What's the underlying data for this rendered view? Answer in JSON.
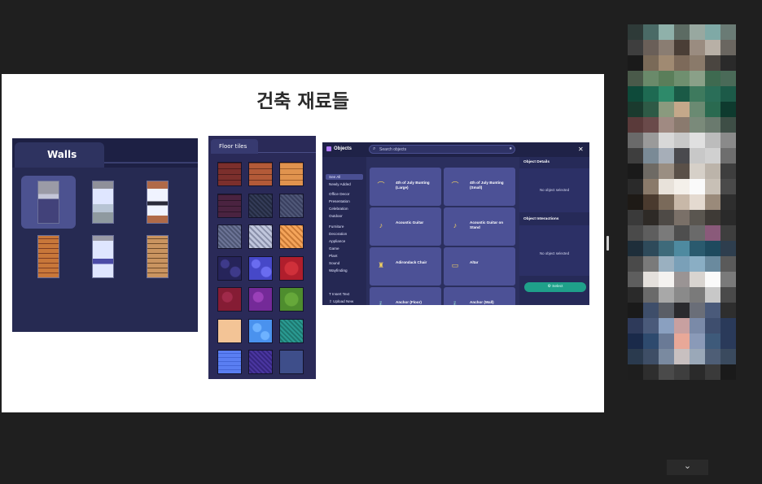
{
  "slide": {
    "title": "건축 재료들"
  },
  "walls": {
    "tab_label": "Walls",
    "items": [
      {
        "name": "wall-gray-purple",
        "style": "w1"
      },
      {
        "name": "wall-light-blue",
        "style": "w2"
      },
      {
        "name": "wall-brick-stripe",
        "style": "w3"
      },
      {
        "name": "wall-orange-brick",
        "style": "w4"
      },
      {
        "name": "wall-blue-stripe",
        "style": "w5"
      },
      {
        "name": "wall-tan-brick",
        "style": "w6"
      }
    ]
  },
  "floor": {
    "tab_label": "Floor tiles",
    "tiles": [
      "t-wood-dark",
      "t-wood-mid",
      "t-wood-light",
      "t-plum",
      "t-dark-diag",
      "t-slate-diag",
      "t-grey-diag",
      "t-silver-diag",
      "t-orange-diag",
      "t-navy-stone",
      "t-blue-stone",
      "t-red",
      "t-crimson",
      "t-violet",
      "t-green",
      "t-peach",
      "t-sky",
      "t-teal",
      "t-royal",
      "t-indigo",
      "t-steel"
    ]
  },
  "objects": {
    "title": "Objects",
    "search_placeholder": "Search objects",
    "categories": [
      {
        "label": "See All",
        "selected": true
      },
      {
        "label": "Newly Added"
      },
      {
        "label": "Office Decor"
      },
      {
        "label": "Presentation"
      },
      {
        "label": "Celebration"
      },
      {
        "label": "Outdoor"
      },
      {
        "label": "Furniture"
      },
      {
        "label": "Decoration"
      },
      {
        "label": "Appliance"
      },
      {
        "label": "Game"
      },
      {
        "label": "Plant"
      },
      {
        "label": "Sound"
      },
      {
        "label": "Wayfinding"
      }
    ],
    "footer_actions": [
      {
        "label": "Insert Text",
        "icon": "text-icon"
      },
      {
        "label": "Upload New",
        "icon": "upload-icon"
      }
    ],
    "items": [
      {
        "label": "4th of July Bunting (Large)",
        "icon": "bunting-icon"
      },
      {
        "label": "4th of July Bunting (Small)",
        "icon": "bunting-icon"
      },
      {
        "label": "Acoustic Guitar",
        "icon": "guitar-icon"
      },
      {
        "label": "Acoustic Guitar on Stand",
        "icon": "guitar-icon"
      },
      {
        "label": "Adirondack Chair",
        "icon": "chair-icon"
      },
      {
        "label": "Altar",
        "icon": "altar-icon"
      },
      {
        "label": "Anchor (Floor)",
        "icon": "anchor-icon"
      },
      {
        "label": "Anchor (Wall)",
        "icon": "anchor-icon"
      }
    ],
    "details": {
      "heading": "Object Details",
      "empty": "No object selected"
    },
    "interactions": {
      "heading": "Object Interactions",
      "empty": "No object selected"
    },
    "select_label": "Select"
  },
  "camera_colors": [
    [
      "#2e3a38",
      "#4a6a66",
      "#8fb1aa",
      "#5c6b63",
      "#98a8a0",
      "#7fa9a6",
      "#6a7b75"
    ],
    [
      "#3e3e3e",
      "#6a5f58",
      "#8a7d72",
      "#4a3e36",
      "#9a8c80",
      "#b8b0a6",
      "#6a6660"
    ],
    [
      "#1a1a1a",
      "#7a6a58",
      "#a08a72",
      "#7d6a5a",
      "#8a7a6a",
      "#4a4540",
      "#2a2a2a"
    ],
    [
      "#4a5a4a",
      "#6a8a6a",
      "#5a7e5a",
      "#6f8f6f",
      "#8aa088",
      "#3e6a50",
      "#4a6a58"
    ],
    [
      "#0e4a3a",
      "#1e6a52",
      "#2e8a6a",
      "#1a5a46",
      "#3e7a5e",
      "#2a6e58",
      "#1c5a48"
    ],
    [
      "#1a3a2e",
      "#2e5a46",
      "#8a9a7e",
      "#c4a88a",
      "#6a8a72",
      "#2a6a50",
      "#0e3a2e"
    ],
    [
      "#5a3a3a",
      "#6a4a4a",
      "#a08a82",
      "#8a7a6e",
      "#7a8a7a",
      "#6a7a6e",
      "#3e4e46"
    ],
    [
      "#6a6a6a",
      "#9a9a9a",
      "#d8d8d8",
      "#c8c8c8",
      "#e0e0e0",
      "#bcbcbc",
      "#8a8a8a"
    ],
    [
      "#3e3e3e",
      "#7a8a96",
      "#a6aeb8",
      "#4a4a4e",
      "#c8c8c8",
      "#d0d0d0",
      "#6e6e6e"
    ],
    [
      "#1a1a1a",
      "#6e6a64",
      "#9a8e82",
      "#5a5048",
      "#d6d0c8",
      "#bcb4aa",
      "#3e3e3e"
    ],
    [
      "#2a2a2a",
      "#8a7a6a",
      "#e8e2da",
      "#f4f0ea",
      "#fafafa",
      "#c8c0b6",
      "#4a4a4a"
    ],
    [
      "#1e1a16",
      "#4a3a2e",
      "#7a6a5a",
      "#c8b8a8",
      "#e4dad0",
      "#9a8a7a",
      "#2e2e2e"
    ],
    [
      "#3a3a3a",
      "#2e2a26",
      "#4e4a46",
      "#7a7068",
      "#5a5650",
      "#3e3a36",
      "#2a2a2a"
    ],
    [
      "#4a4a4a",
      "#5e5e5e",
      "#7a7a7a",
      "#4e4e4e",
      "#6a6a6a",
      "#8a5a7a",
      "#3e3e3e"
    ],
    [
      "#1e2e3a",
      "#2e4a5a",
      "#3e6a7a",
      "#4e8aa0",
      "#2a5a6e",
      "#1e4a5e",
      "#2e3e4e"
    ],
    [
      "#4a4a4a",
      "#7a7a7a",
      "#9ab0c0",
      "#7aa0b8",
      "#8aaec4",
      "#6a8a9e",
      "#5a5a5a"
    ],
    [
      "#5e5e5e",
      "#e4e0dc",
      "#f4f2f0",
      "#9a9494",
      "#d8d4d0",
      "#fafafa",
      "#7a7a7a"
    ],
    [
      "#2a2a2a",
      "#6a6a6a",
      "#a8a8a8",
      "#8a8a8a",
      "#7a7a7a",
      "#c8c8c8",
      "#4a4a4a"
    ],
    [
      "#1a1a1a",
      "#3e4e6a",
      "#5a5e66",
      "#2a2a2e",
      "#6a6e78",
      "#4a5a7a",
      "#2e2e2e"
    ],
    [
      "#2e3a5a",
      "#4a5a7a",
      "#8aa0c0",
      "#c8a0a0",
      "#7a8aa8",
      "#3e4e6e",
      "#2a3a5a"
    ],
    [
      "#1a2a4a",
      "#2e4a6e",
      "#6a7a96",
      "#e8a898",
      "#8a9ab8",
      "#3e5a7a",
      "#2a3a5a"
    ],
    [
      "#2a3a4e",
      "#3e4e66",
      "#7a8aa0",
      "#c8c0c0",
      "#9aa8b8",
      "#4e5e76",
      "#3a4a5e"
    ],
    [
      "#1e1e1e",
      "#2e2e2e",
      "#4a4a4a",
      "#3e3e3e",
      "#2a2a2a",
      "#3a3a3a",
      "#1a1a1a"
    ]
  ]
}
